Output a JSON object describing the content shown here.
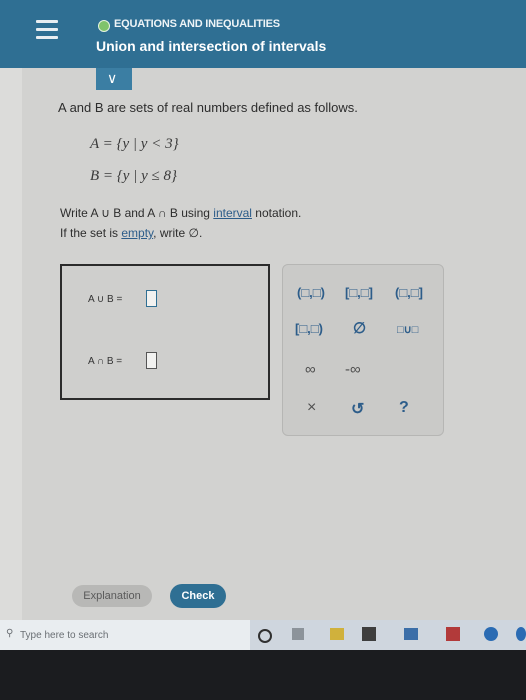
{
  "header": {
    "topic": "EQUATIONS AND INEQUALITIES",
    "title": "Union and intersection of intervals"
  },
  "collapse_symbol": "∨",
  "problem": {
    "intro": "A and B are sets of real numbers defined as follows.",
    "setA": "A = {y | y < 3}",
    "setB": "B = {y | y ≤ 8}",
    "instruction_line1_pre": "Write A ∪ B and A ∩ B using ",
    "instruction_line1_link": "interval",
    "instruction_line1_post": " notation.",
    "instruction_line2_pre": "If the set is ",
    "instruction_line2_link": "empty",
    "instruction_line2_post": ", write ∅."
  },
  "answers": {
    "union_label": "A ∪ B =",
    "intersection_label": "A ∩ B ="
  },
  "keypad": {
    "open_open": "(□,□)",
    "closed_closed": "[□,□]",
    "open_closed": "(□,□]",
    "closed_open": "[□,□)",
    "empty_set": "∅",
    "union": "□∪□",
    "infinity": "∞",
    "neg_infinity": "-∞",
    "clear": "×",
    "undo": "↺",
    "help": "?"
  },
  "buttons": {
    "explanation": "Explanation",
    "check": "Check"
  },
  "taskbar": {
    "search_placeholder": "Type here to search"
  },
  "colors": {
    "header_bg": "#2f6f93",
    "accent": "#2d5d8a",
    "topic_dot": "#7fc36b"
  }
}
